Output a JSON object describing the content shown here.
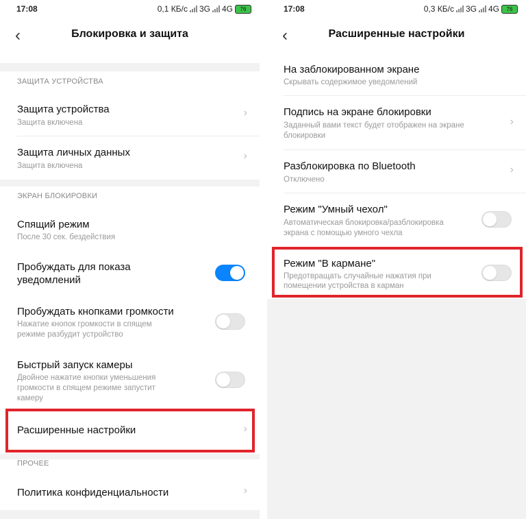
{
  "left": {
    "status": {
      "time": "17:08",
      "speed": "0,1 КБ/с",
      "net1": "3G",
      "net2": "4G",
      "battery": "76"
    },
    "title": "Блокировка и защита",
    "sections": [
      {
        "label": "ЗАЩИТА УСТРОЙСТВА"
      },
      {
        "label": "ЭКРАН БЛОКИРОВКИ"
      },
      {
        "label": "ПРОЧЕЕ"
      }
    ],
    "items": {
      "device_protection": {
        "title": "Защита устройства",
        "subtitle": "Защита включена"
      },
      "personal_data": {
        "title": "Защита личных данных",
        "subtitle": "Защита включена"
      },
      "sleep": {
        "title": "Спящий режим",
        "subtitle": "После 30 сек. бездействия"
      },
      "wake_notify": {
        "title_l1": "Пробуждать для показа",
        "title_l2": "уведомлений",
        "toggle": true
      },
      "wake_volume": {
        "title": "Пробуждать кнопками громкости",
        "sub_l1": "Нажатие кнопок громкости в спящем",
        "sub_l2": "режиме разбудит устройство",
        "toggle": false
      },
      "quick_camera": {
        "title": "Быстрый запуск камеры",
        "sub_l1": "Двойное нажатие кнопки уменьшения",
        "sub_l2": "громкости в спящем режиме запустит",
        "sub_l3": "камеру",
        "toggle": false
      },
      "advanced": {
        "title": "Расширенные настройки"
      },
      "privacy": {
        "title": "Политика конфиденциальности"
      }
    }
  },
  "right": {
    "status": {
      "time": "17:08",
      "speed": "0,3 КБ/с",
      "net1": "3G",
      "net2": "4G",
      "battery": "76"
    },
    "title": "Расширенные настройки",
    "items": {
      "lockscreen": {
        "title": "На заблокированном экране",
        "subtitle": "Скрывать содержимое уведомлений"
      },
      "signature": {
        "title": "Подпись на экране блокировки",
        "sub_l1": "Заданный вами текст будет отображен на экране",
        "sub_l2": "блокировки"
      },
      "bluetooth": {
        "title": "Разблокировка по Bluetooth",
        "subtitle": "Отключено"
      },
      "smart_cover": {
        "title": "Режим \"Умный чехол\"",
        "sub_l1": "Автоматическая блокировка/разблокировка",
        "sub_l2": "экрана с помощью умного чехла",
        "toggle": false
      },
      "pocket": {
        "title": "Режим \"В кармане\"",
        "sub_l1": "Предотвращать случайные нажатия при",
        "sub_l2": "помещении устройства в карман",
        "toggle": false
      }
    }
  },
  "icons": {
    "back": "back-arrow-icon",
    "chevron": "chevron-right-icon",
    "signal": "signal-icon",
    "battery": "battery-icon"
  },
  "colors": {
    "toggle_on": "#0a84ff",
    "highlight": "#e0242b",
    "section_bg": "#f2f2f2"
  }
}
